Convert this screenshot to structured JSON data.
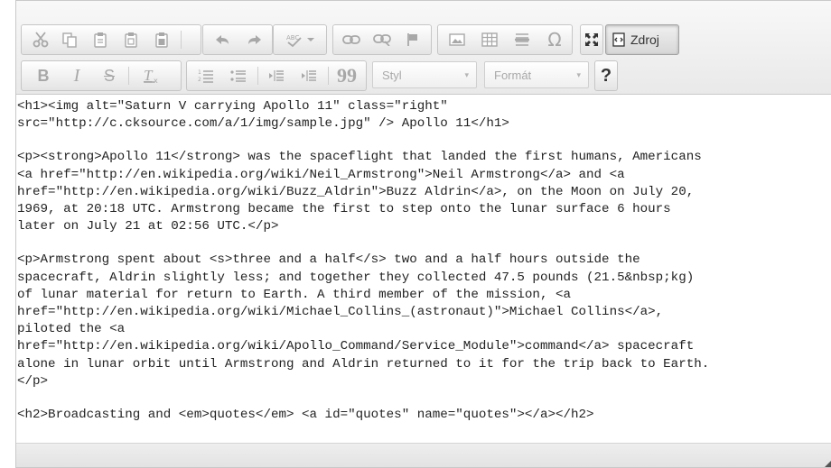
{
  "toolbar": {
    "source_label": "Zdroj",
    "style_combo": {
      "label": "Styl"
    },
    "format_combo": {
      "label": "Formát"
    },
    "help_label": "?",
    "icons": {
      "cut": "scissors-icon",
      "copy": "copy-icon",
      "paste": "paste-icon",
      "paste_text": "paste-text-icon",
      "paste_word": "paste-word-icon",
      "undo": "undo-arrow-icon",
      "redo": "redo-arrow-icon",
      "spellcheck": "spellcheck-icon",
      "link": "link-icon",
      "unlink": "unlink-icon",
      "anchor": "flag-icon",
      "image": "image-icon",
      "table": "table-icon",
      "hr": "horizontal-line-icon",
      "special_char": "omega-icon",
      "maximize": "maximize-icon",
      "source": "source-document-icon",
      "bold": "bold-icon",
      "italic": "italic-icon",
      "strike": "strikethrough-icon",
      "remove_format": "remove-format-icon",
      "numbered_list": "numbered-list-icon",
      "bulleted_list": "bulleted-list-icon",
      "outdent": "outdent-icon",
      "indent": "indent-icon",
      "blockquote": "blockquote-icon"
    }
  },
  "source": {
    "paragraphs": [
      [
        "<h1><img alt=\"Saturn V carrying Apollo 11\" class=\"right\"",
        "src=\"http://c.cksource.com/a/1/img/sample.jpg\" /> Apollo 11</h1>"
      ],
      [
        "<p><strong>Apollo 11</strong> was the spaceflight that landed the first humans, Americans",
        "<a href=\"http://en.wikipedia.org/wiki/Neil_Armstrong\">Neil Armstrong</a> and <a",
        "href=\"http://en.wikipedia.org/wiki/Buzz_Aldrin\">Buzz Aldrin</a>, on the Moon on July 20,",
        "1969, at 20:18 UTC. Armstrong became the first to step onto the lunar surface 6 hours",
        "later on July 21 at 02:56 UTC.</p>"
      ],
      [
        "<p>Armstrong spent about <s>three and a half</s> two and a half hours outside the",
        "spacecraft, Aldrin slightly less; and together they collected 47.5 pounds (21.5&nbsp;kg)",
        "of lunar material for return to Earth. A third member of the mission, <a",
        "href=\"http://en.wikipedia.org/wiki/Michael_Collins_(astronaut)\">Michael Collins</a>,",
        "piloted the <a",
        "href=\"http://en.wikipedia.org/wiki/Apollo_Command/Service_Module\">command</a> spacecraft",
        "alone in lunar orbit until Armstrong and Aldrin returned to it for the trip back to Earth.",
        "</p>"
      ],
      [
        "<h2>Broadcasting and <em>quotes</em> <a id=\"quotes\" name=\"quotes\"></a></h2>"
      ]
    ]
  }
}
